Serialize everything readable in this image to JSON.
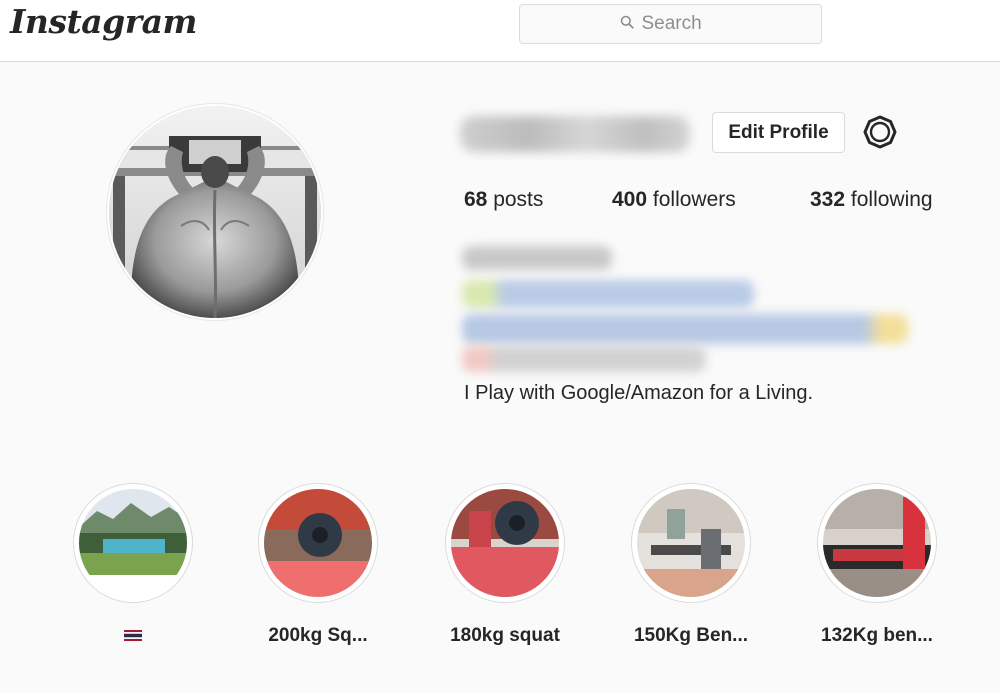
{
  "app": {
    "logo_text": "Instagram"
  },
  "search": {
    "placeholder": "Search",
    "icon": "search-icon"
  },
  "profile": {
    "edit_profile_label": "Edit Profile",
    "settings_icon": "gear-icon",
    "stats": {
      "posts_count": "68",
      "posts_label": "posts",
      "followers_count": "400",
      "followers_label": "followers",
      "following_count": "332",
      "following_label": "following"
    },
    "bio": "I Play with Google/Amazon for a Living."
  },
  "highlights": [
    {
      "label": "",
      "icon": "thailand-flag-icon"
    },
    {
      "label": "200kg Sq..."
    },
    {
      "label": "180kg squat"
    },
    {
      "label": "150Kg Ben..."
    },
    {
      "label": "132Kg ben..."
    }
  ],
  "colors": {
    "page_background": "#fafafa",
    "border": "#dbdbdb",
    "text": "#262626",
    "muted": "#8e8e8e"
  }
}
